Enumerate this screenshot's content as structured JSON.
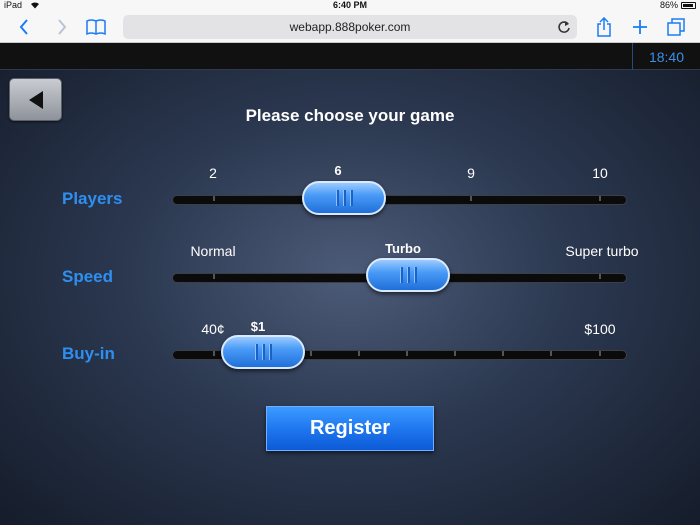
{
  "status": {
    "device": "iPad",
    "time": "6:40 PM",
    "battery": "86%"
  },
  "browser": {
    "url": "webapp.888poker.com"
  },
  "game": {
    "clock": "18:40",
    "title": "Please choose your game",
    "players": {
      "label": "Players",
      "options": [
        "2",
        "6",
        "9",
        "10"
      ],
      "selected": "6"
    },
    "speed": {
      "label": "Speed",
      "options": [
        "Normal",
        "Turbo",
        "Super turbo"
      ],
      "selected": "Turbo"
    },
    "buyin": {
      "label": "Buy-in",
      "min_label": "40¢",
      "selected": "$1",
      "max_label": "$100"
    },
    "register_label": "Register"
  },
  "icons": [
    "back-arrow-icon",
    "chevron-left-icon",
    "chevron-right-icon",
    "bookmarks-icon",
    "reload-icon",
    "share-icon",
    "plus-icon",
    "tabs-icon",
    "wifi-icon",
    "battery-icon"
  ]
}
